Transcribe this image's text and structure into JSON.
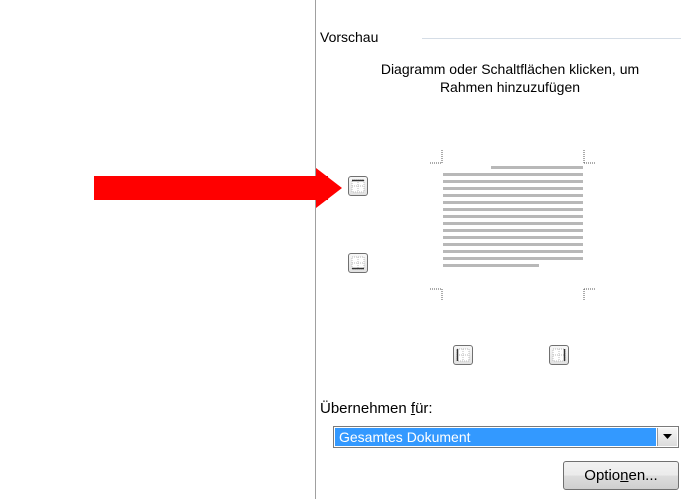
{
  "dialog": {
    "preview_group_label": "Vorschau",
    "instruction": "Diagramm oder Schaltflächen klicken, um Rahmen hinzuzufügen",
    "apply_to_label_prefix": "Übernehmen ",
    "apply_to_label_accel": "f",
    "apply_to_label_suffix": "ür:",
    "apply_to_value": "Gesamtes Dokument",
    "options_prefix": "Optio",
    "options_accel": "n",
    "options_suffix": "en..."
  },
  "icons": {
    "arrow": "red-arrow",
    "border_top": "border-top-icon",
    "border_bottom": "border-bottom-icon",
    "border_left": "border-left-icon",
    "border_right": "border-right-icon",
    "dropdown": "chevron-down-icon"
  },
  "colors": {
    "arrow": "#ff0000",
    "selection": "#3399ff",
    "preview_lines": "#b8b8b8"
  }
}
